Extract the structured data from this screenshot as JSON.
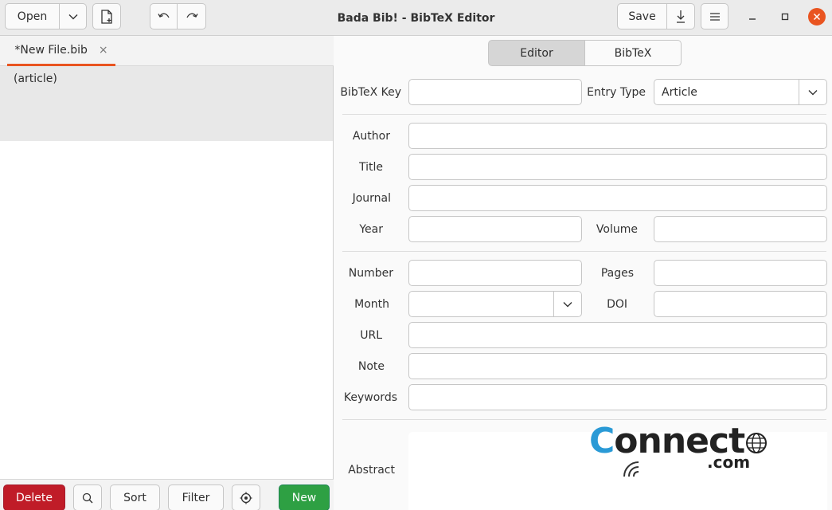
{
  "window": {
    "title": "Bada Bib! - BibTeX Editor"
  },
  "toolbar": {
    "open_label": "Open",
    "save_label": "Save"
  },
  "tab": {
    "label": "*New File.bib",
    "close_glyph": "×"
  },
  "entries": [
    {
      "label": "(article)"
    }
  ],
  "bottom": {
    "delete_label": "Delete",
    "sort_label": "Sort",
    "filter_label": "Filter",
    "new_label": "New"
  },
  "view_switch": {
    "editor": "Editor",
    "bibtex": "BibTeX"
  },
  "form": {
    "bibtex_key": {
      "label": "BibTeX Key",
      "value": ""
    },
    "entry_type": {
      "label": "Entry Type",
      "value": "Article"
    },
    "author": {
      "label": "Author",
      "value": ""
    },
    "title": {
      "label": "Title",
      "value": ""
    },
    "journal": {
      "label": "Journal",
      "value": ""
    },
    "year": {
      "label": "Year",
      "value": ""
    },
    "volume": {
      "label": "Volume",
      "value": ""
    },
    "number": {
      "label": "Number",
      "value": ""
    },
    "pages": {
      "label": "Pages",
      "value": ""
    },
    "month": {
      "label": "Month",
      "value": ""
    },
    "doi": {
      "label": "DOI",
      "value": ""
    },
    "url": {
      "label": "URL",
      "value": ""
    },
    "note": {
      "label": "Note",
      "value": ""
    },
    "keywords": {
      "label": "Keywords",
      "value": ""
    },
    "abstract": {
      "label": "Abstract",
      "value": ""
    }
  },
  "watermark": {
    "main_pre": "C",
    "main_rest": "onnect",
    "suffix": ".com"
  },
  "colors": {
    "accent": "#e95420",
    "danger": "#c01c28",
    "success": "#2ea043",
    "brand_blue": "#2a9ad6"
  }
}
